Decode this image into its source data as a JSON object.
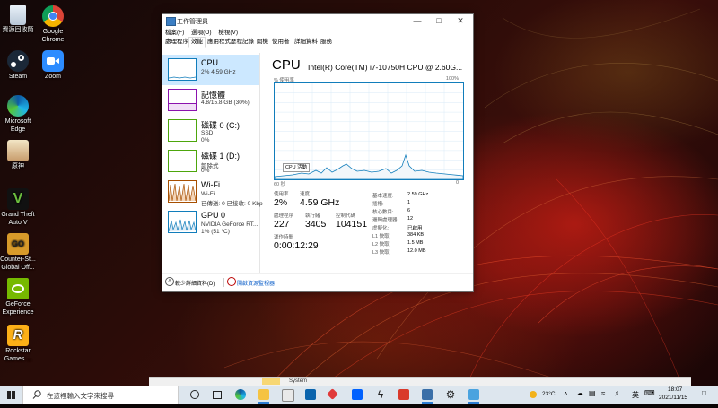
{
  "desktop": {
    "icons": [
      {
        "name": "recycle-bin",
        "label": "資源回收筒"
      },
      {
        "name": "chrome",
        "label": "Google Chrome"
      },
      {
        "name": "steam",
        "label": "Steam"
      },
      {
        "name": "zoom",
        "label": "Zoom"
      },
      {
        "name": "edge",
        "label": "Microsoft Edge"
      },
      {
        "name": "genshin",
        "label": "原神"
      },
      {
        "name": "gta-v",
        "label": "Grand Theft Auto V"
      },
      {
        "name": "csgo",
        "label": "Counter-St... Global Off..."
      },
      {
        "name": "geforce-experience",
        "label": "GeForce Experience"
      },
      {
        "name": "rockstar",
        "label": "Rockstar Games ..."
      }
    ]
  },
  "task_manager": {
    "title": "工作管理員",
    "menu": [
      "檔案(F)",
      "選項(O)",
      "檢視(V)"
    ],
    "tabs": [
      "處理程序",
      "效能",
      "應用程式歷程記錄",
      "開機",
      "使用者",
      "詳細資料",
      "服務"
    ],
    "active_tab": "效能",
    "sidebar": [
      {
        "title": "CPU",
        "sub1": "2%  4.59 GHz",
        "sub2": ""
      },
      {
        "title": "記憶體",
        "sub1": "4.8/15.8 GB (30%)",
        "sub2": ""
      },
      {
        "title": "磁碟 0 (C:)",
        "sub1": "SSD",
        "sub2": "0%"
      },
      {
        "title": "磁碟 1 (D:)",
        "sub1": "卸除式",
        "sub2": "0%"
      },
      {
        "title": "Wi-Fi",
        "sub1": "Wi-Fi",
        "sub2": "已傳送: 0  已接收: 0 Kbp"
      },
      {
        "title": "GPU 0",
        "sub1": "NVIDIA GeForce RT...",
        "sub2": "1% (51 °C)"
      }
    ],
    "cpu": {
      "heading": "CPU",
      "model": "Intel(R) Core(TM) i7-10750H CPU @ 2.60G...",
      "graph_label_left": "% 使用率",
      "graph_label_right": "100%",
      "graph_tooltip": "CPU 活動",
      "axis_left": "60 秒",
      "axis_right": "0",
      "stats": {
        "usage_label": "使用率",
        "usage_value": "2%",
        "speed_label": "速度",
        "speed_value": "4.59 GHz",
        "processes_label": "處理程序",
        "processes_value": "227",
        "threads_label": "執行緒",
        "threads_value": "3405",
        "handles_label": "控制代碼",
        "handles_value": "104151",
        "uptime_label": "運作時間",
        "uptime_value": "0:00:12:29"
      },
      "details": [
        {
          "label": "基本速度:",
          "value": "2.59 GHz"
        },
        {
          "label": "插槽:",
          "value": "1"
        },
        {
          "label": "核心數目:",
          "value": "6"
        },
        {
          "label": "邏輯處理器:",
          "value": "12"
        },
        {
          "label": "虛擬化:",
          "value": "已啟用"
        },
        {
          "label": "L1 快取:",
          "value": "384 KB"
        },
        {
          "label": "L2 快取:",
          "value": "1.5 MB"
        },
        {
          "label": "L3 快取:",
          "value": "12.0 MB"
        }
      ]
    },
    "footer": {
      "fewer_details": "較少詳細資料(D)",
      "open_resource_monitor": "開啟資源監視器"
    }
  },
  "background_window": {
    "title": "System"
  },
  "taskbar": {
    "search_placeholder": "在這裡輸入文字來搜尋",
    "weather": "23°C",
    "ime": "英",
    "time": "18:07",
    "date": "2021/11/15"
  },
  "colors": {
    "cpu_blue": "#117dbb",
    "memory_purple": "#8b12ae",
    "disk_green": "#4da60c",
    "wifi_orange": "#a74f01",
    "gpu_blue": "#117dbb",
    "selection": "#cce8ff",
    "taskbar": "#dde6ee"
  }
}
